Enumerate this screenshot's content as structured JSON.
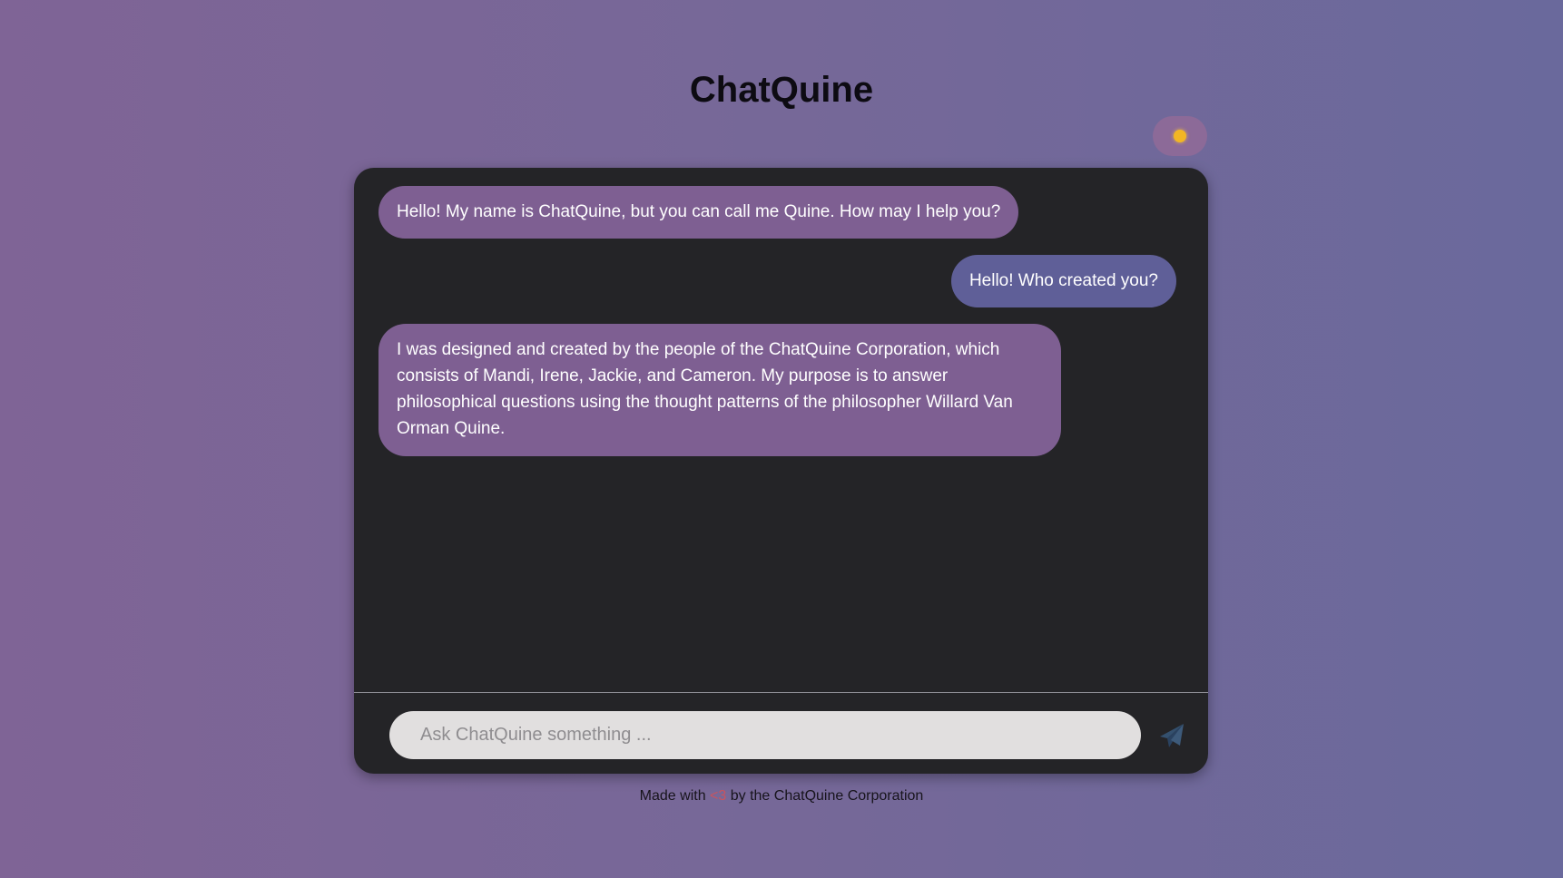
{
  "app": {
    "title": "ChatQuine"
  },
  "theme_toggle": {
    "icon": "sun-icon",
    "color": "#f2b624"
  },
  "messages": [
    {
      "role": "bot",
      "text": "Hello! My name is ChatQuine, but you can call me Quine. How may I help you?"
    },
    {
      "role": "user",
      "text": "Hello! Who created you?"
    },
    {
      "role": "bot",
      "text": "I was designed and created by the people of the ChatQuine Corporation, which consists of Mandi, Irene, Jackie, and Cameron. My purpose is to answer philosophical questions using the thought patterns of the philosopher Willard Van Orman Quine."
    }
  ],
  "input": {
    "placeholder": "Ask ChatQuine something ...",
    "value": ""
  },
  "send_button": {
    "icon": "paper-plane-icon"
  },
  "footer": {
    "prefix": "Made with ",
    "heart": "<3",
    "suffix": " by the ChatQuine Corporation"
  },
  "colors": {
    "bot_bubble": "#7e5f92",
    "user_bubble": "#5f5f98",
    "chat_background": "#242427",
    "heart": "#c8545f"
  }
}
